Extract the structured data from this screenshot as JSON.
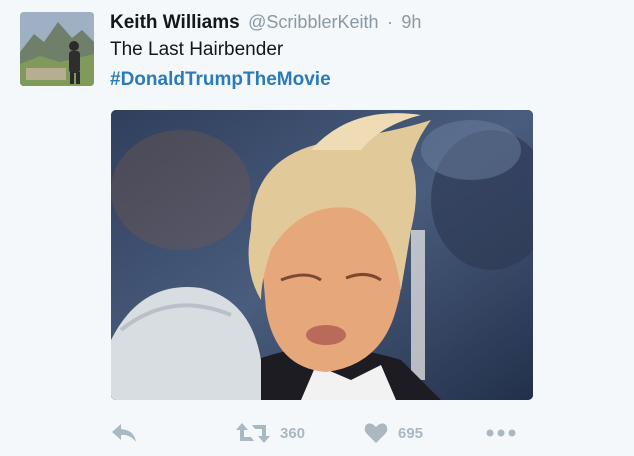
{
  "tweet": {
    "author_name": "Keith Williams",
    "handle": "@ScribblerKeith",
    "separator": "·",
    "time": "9h",
    "text": "The Last Hairbender",
    "hashtag": "#DonaldTrumpTheMovie"
  },
  "actions": {
    "reply_icon": "reply-icon",
    "retweet_icon": "retweet-icon",
    "retweet_count": "360",
    "like_icon": "heart-icon",
    "like_count": "695",
    "more_icon": "more-icon"
  },
  "colors": {
    "background": "#f5f8fa",
    "name": "#14171a",
    "meta": "#8899a6",
    "hashtag": "#2b7bb9",
    "action": "#aab8c2"
  }
}
